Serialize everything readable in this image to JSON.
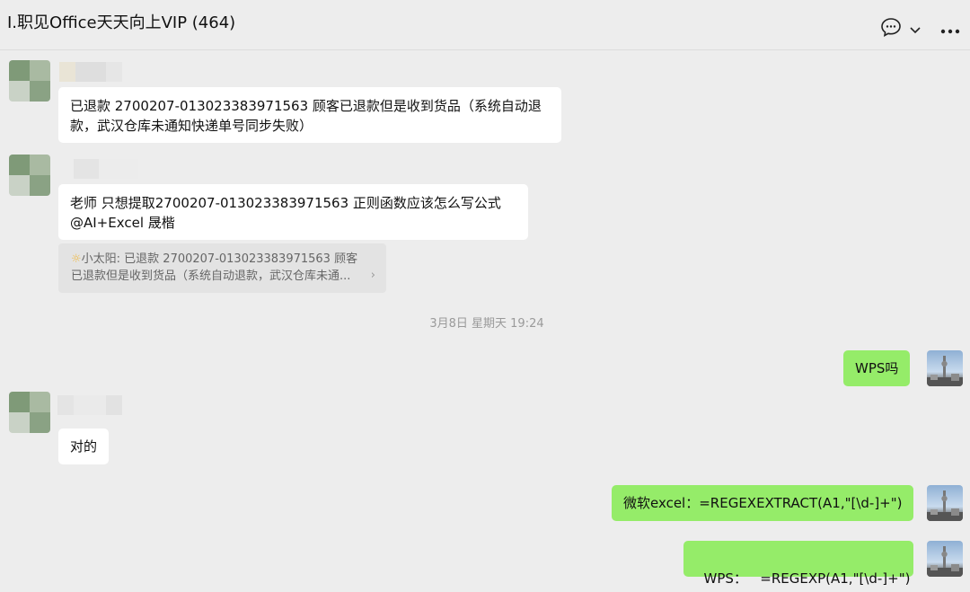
{
  "header": {
    "title": "I.职见Office天天向上VIP (464)"
  },
  "messages": [
    {
      "side": "left",
      "text_line1": "已退款 2700207-013023383971563 顾客已退款但是收到货品（系统自动退",
      "text_line2": "款，武汉仓库未通知快递单号同步失败）"
    },
    {
      "side": "left",
      "text_line1": "老师  只想提取2700207-013023383971563  正则函数应该怎么写公式",
      "text_line2": "@AI+Excel 晟楷",
      "quote": {
        "icon": "sun-icon",
        "line1": "小太阳: 已退款 2700207-013023383971563 顾客",
        "line2": "已退款但是收到货品（系统自动退款，武汉仓库未通..."
      }
    },
    {
      "side": "right",
      "text": "WPS吗"
    },
    {
      "side": "left",
      "text": "对的"
    },
    {
      "side": "right",
      "text": "微软excel：=REGEXEXTRACT(A1,\"[\\d-]+\")"
    },
    {
      "side": "right",
      "text": "WPS：   =REGEXP(A1,\"[\\d-]+\")"
    }
  ],
  "timestamp": "3月8日 星期天 19:24",
  "quote_chevron": "›",
  "colors": {
    "background": "#ededed",
    "my_bubble": "#95ec69",
    "their_bubble": "#ffffff"
  }
}
